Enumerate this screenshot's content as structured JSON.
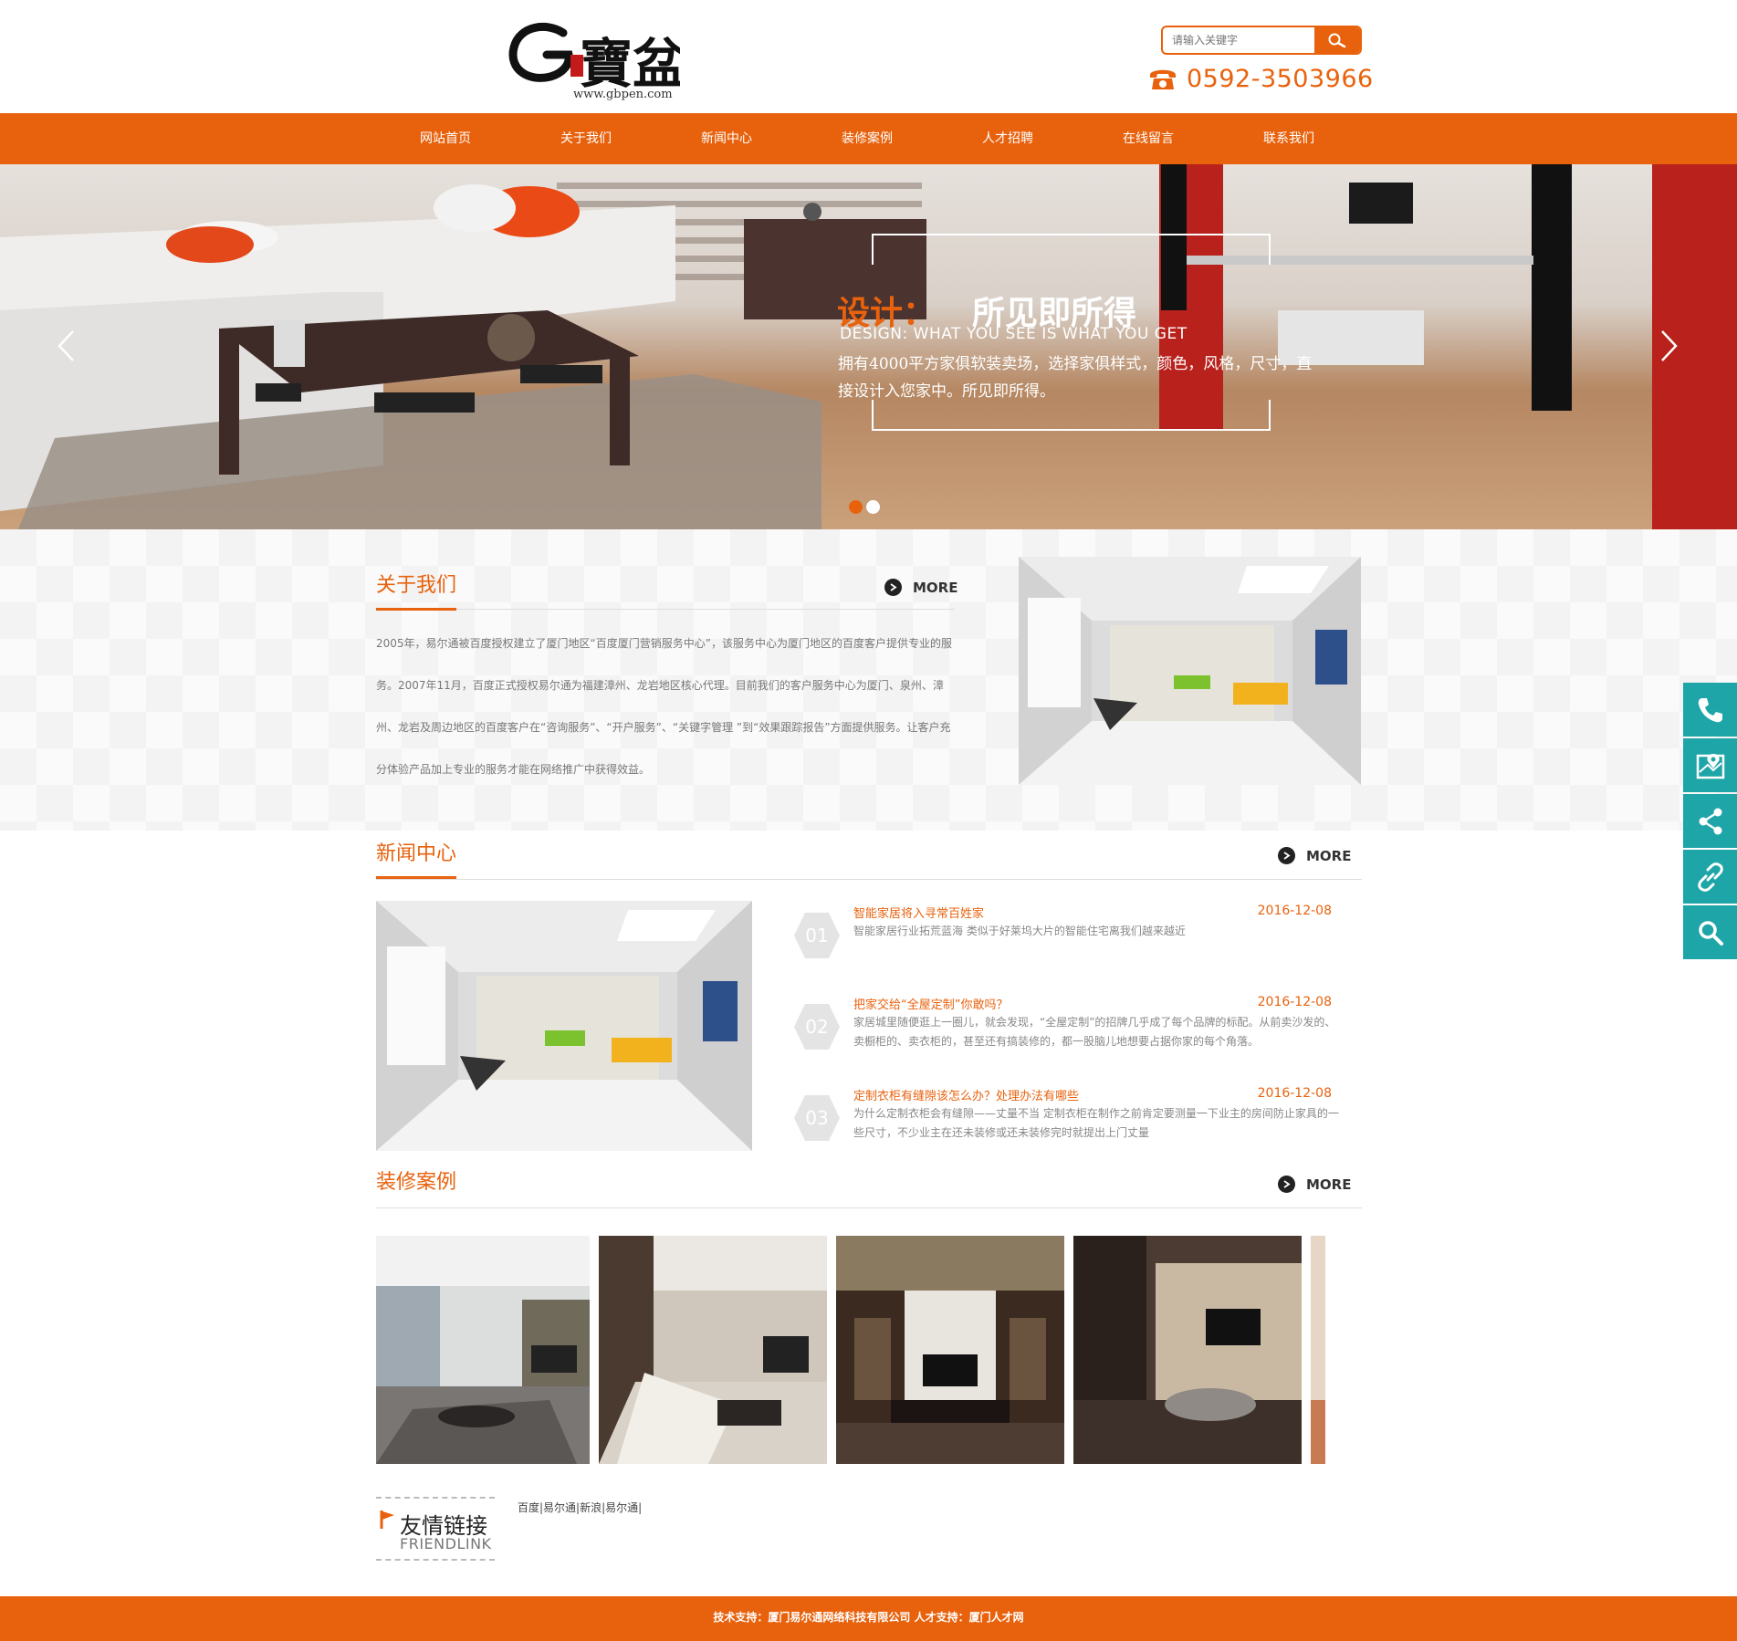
{
  "header": {
    "logo_domain": "www.gbpen.com",
    "search_placeholder": "请输入关键字",
    "phone": "0592-3503966"
  },
  "nav": {
    "items": [
      "网站首页",
      "关于我们",
      "新闻中心",
      "装修案例",
      "人才招聘",
      "在线留言",
      "联系我们"
    ]
  },
  "banner": {
    "title_orange": "设计：",
    "title_white": "所见即所得",
    "subtitle": "DESIGN: WHAT YOU SEE IS WHAT YOU GET",
    "desc": "拥有4000平方家俱软装卖场，选择家俱样式，颜色，风格，尺寸，直接设计入您家中。所见即所得。",
    "slides": 2,
    "active_slide": 1
  },
  "about": {
    "title": "关于我们",
    "more": "MORE",
    "text": "2005年，易尔通被百度授权建立了厦门地区“百度厦门营销服务中心”，该服务中心为厦门地区的百度客户提供专业的服务。2007年11月，百度正式授权易尔通为福建漳州、龙岩地区核心代理。目前我们的客户服务中心为厦门、泉州、漳州、龙岩及周边地区的百度客户在“咨询服务”、“开户服务”、“关键字管理 ”到“效果跟踪报告”方面提供服务。让客户充分体验产品加上专业的服务才能在网络推广中获得效益。"
  },
  "news": {
    "title": "新闻中心",
    "more": "MORE",
    "items": [
      {
        "num": "01",
        "title": "智能家居将入寻常百姓家",
        "date": "2016-12-08",
        "desc": "智能家居行业拓荒蓝海 类似于好莱坞大片的智能住宅离我们越来越近"
      },
      {
        "num": "02",
        "title": "把家交给“全屋定制”你敢吗？",
        "date": "2016-12-08",
        "desc": "家居城里随便逛上一圈儿，就会发现，“全屋定制”的招牌几乎成了每个品牌的标配。从前卖沙发的、卖橱柜的、卖衣柜的，甚至还有搞装修的，都一股脑儿地想要占据你家的每个角落。"
      },
      {
        "num": "03",
        "title": "定制衣柜有缝隙该怎么办？处理办法有哪些",
        "date": "2016-12-08",
        "desc": "为什么定制衣柜会有缝隙——丈量不当 定制衣柜在制作之前肯定要测量一下业主的房间防止家具的一些尺寸，不少业主在还未装修或还未装修完时就提出上门丈量"
      }
    ]
  },
  "cases": {
    "title": "装修案例",
    "more": "MORE"
  },
  "friend": {
    "title_cn": "友情链接",
    "title_en": "FRIENDLINK",
    "links": [
      "百度|",
      "易尔通|",
      "新浪|",
      "易尔通|"
    ]
  },
  "footer": {
    "text": "技术支持：厦门易尔通网络科技有限公司 人才支持：厦门人才网"
  },
  "colors": {
    "accent": "#e8620d",
    "side_bar": "#1ea5a8"
  },
  "side_tools": [
    "phone-icon",
    "map-icon",
    "share-icon",
    "link-icon",
    "search-icon"
  ]
}
